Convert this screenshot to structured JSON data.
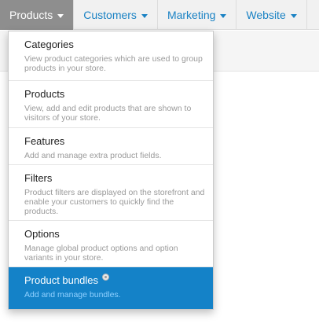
{
  "topnav": {
    "items": [
      {
        "label": "Products",
        "active": true
      },
      {
        "label": "Customers"
      },
      {
        "label": "Marketing"
      },
      {
        "label": "Website"
      }
    ]
  },
  "dropdown": {
    "items": [
      {
        "title": "Categories",
        "desc": "View product categories which are used to group products in your store."
      },
      {
        "title": "Products",
        "desc": "View, add and edit products that are shown to visitors of your store."
      },
      {
        "title": "Features",
        "desc": "Add and manage extra product fields."
      },
      {
        "title": "Filters",
        "desc": "Product filters are displayed on the storefront and enable your customers to quickly find the products."
      },
      {
        "title": "Options",
        "desc": "Manage global product options and option variants in your store."
      },
      {
        "title": "Product bundles",
        "desc": "Add and manage bundles.",
        "active": true,
        "icon": "info-icon"
      }
    ]
  },
  "colors": {
    "accent": "#1482c8",
    "nav_active_bg": "#8e8e8e",
    "nav_link": "#1a82c4"
  }
}
